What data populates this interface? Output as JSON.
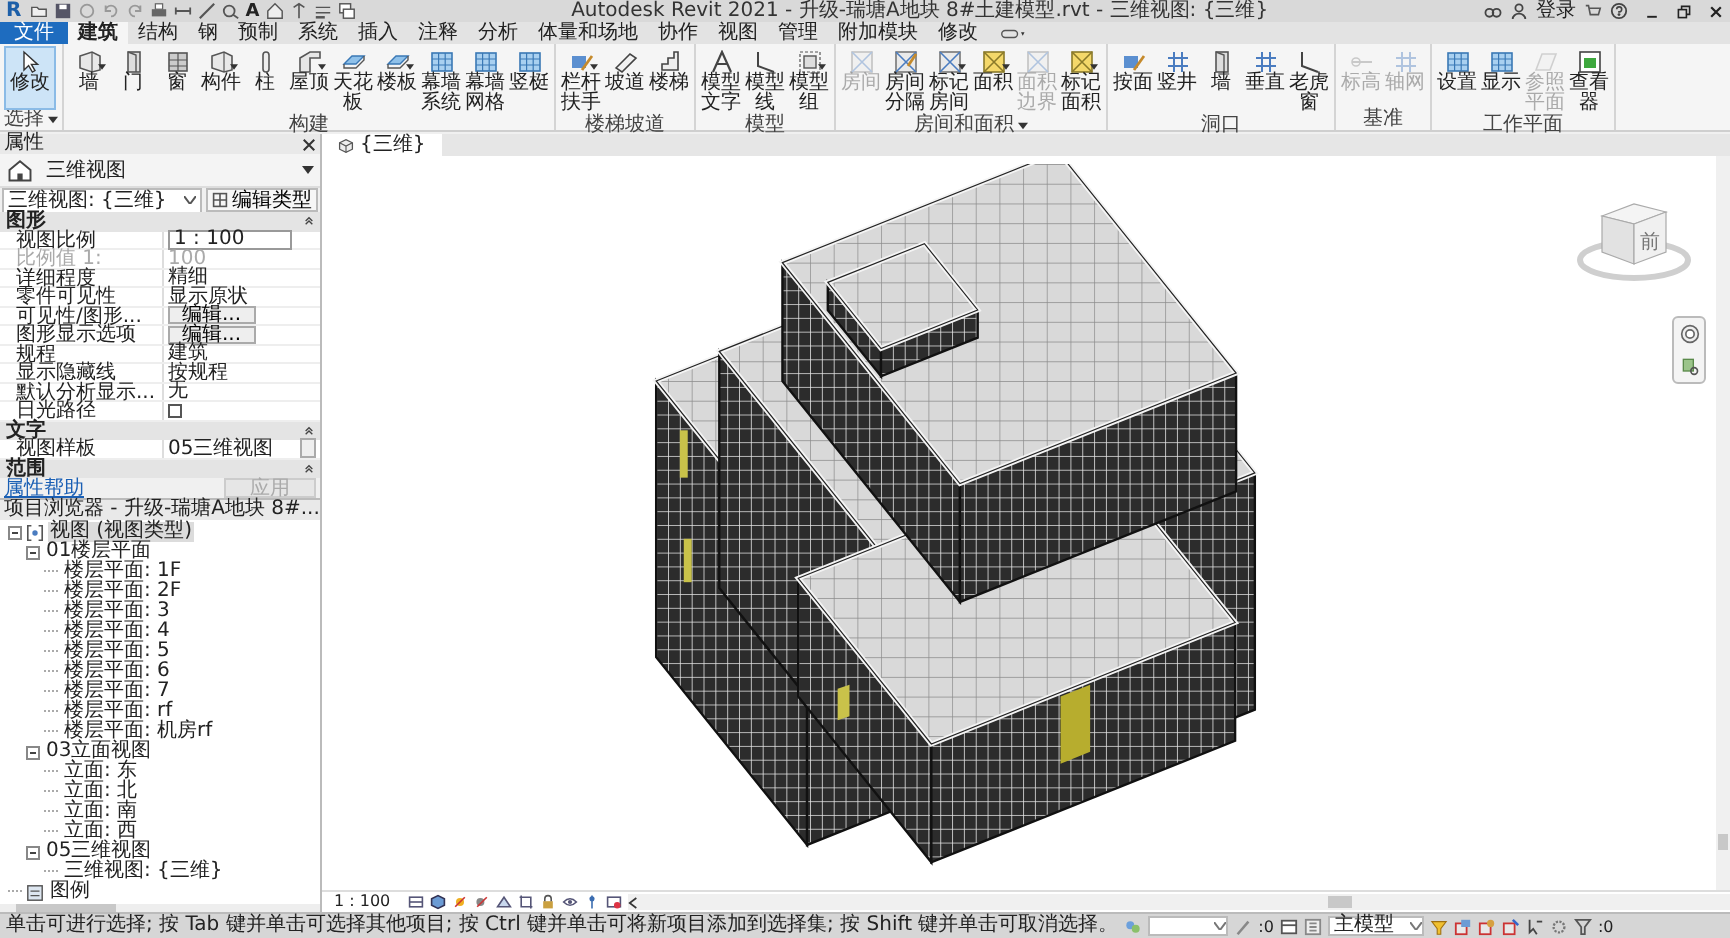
{
  "title_bar": {
    "app_letter": "R",
    "text_tool": "A",
    "title": "Autodesk Revit 2021 - 升级-瑞塘A地块 8#土建模型.rvt - 三维视图: {三维}",
    "sign_in": "登录"
  },
  "ribbon_tabs": [
    {
      "label": "文件",
      "kind": "file",
      "selected": false
    },
    {
      "label": "建筑",
      "kind": "tab",
      "selected": true
    },
    {
      "label": "结构",
      "kind": "tab",
      "selected": false
    },
    {
      "label": "钢",
      "kind": "tab",
      "selected": false
    },
    {
      "label": "预制",
      "kind": "tab",
      "selected": false
    },
    {
      "label": "系统",
      "kind": "tab",
      "selected": false
    },
    {
      "label": "插入",
      "kind": "tab",
      "selected": false
    },
    {
      "label": "注释",
      "kind": "tab",
      "selected": false
    },
    {
      "label": "分析",
      "kind": "tab",
      "selected": false
    },
    {
      "label": "体量和场地",
      "kind": "tab",
      "selected": false
    },
    {
      "label": "协作",
      "kind": "tab",
      "selected": false
    },
    {
      "label": "视图",
      "kind": "tab",
      "selected": false
    },
    {
      "label": "管理",
      "kind": "tab",
      "selected": false
    },
    {
      "label": "附加模块",
      "kind": "tab",
      "selected": false
    },
    {
      "label": "修改",
      "kind": "tab",
      "selected": false
    }
  ],
  "ribbon_panels": [
    {
      "label": "选择",
      "has_menu": true,
      "buttons": [
        {
          "label": "修改",
          "selected": true,
          "disabled": false,
          "has_menu": false
        }
      ]
    },
    {
      "label": "构建",
      "has_menu": false,
      "buttons": [
        {
          "label": "墙",
          "selected": false,
          "disabled": false,
          "has_menu": true
        },
        {
          "label": "门",
          "selected": false,
          "disabled": false,
          "has_menu": false
        },
        {
          "label": "窗",
          "selected": false,
          "disabled": false,
          "has_menu": false
        },
        {
          "label": "构件",
          "selected": false,
          "disabled": false,
          "has_menu": true
        },
        {
          "label": "柱",
          "selected": false,
          "disabled": false,
          "has_menu": false
        },
        {
          "label": "屋顶",
          "selected": false,
          "disabled": false,
          "has_menu": true
        },
        {
          "label": "天花板",
          "selected": false,
          "disabled": false,
          "has_menu": false
        },
        {
          "label": "楼板",
          "selected": false,
          "disabled": false,
          "has_menu": true
        },
        {
          "label": "幕墙系统",
          "selected": false,
          "disabled": false,
          "has_menu": false
        },
        {
          "label": "幕墙网格",
          "selected": false,
          "disabled": false,
          "has_menu": false
        },
        {
          "label": "竖梃",
          "selected": false,
          "disabled": false,
          "has_menu": false
        }
      ]
    },
    {
      "label": "楼梯坡道",
      "has_menu": false,
      "buttons": [
        {
          "label": "栏杆扶手",
          "selected": false,
          "disabled": false,
          "has_menu": true
        },
        {
          "label": "坡道",
          "selected": false,
          "disabled": false,
          "has_menu": false
        },
        {
          "label": "楼梯",
          "selected": false,
          "disabled": false,
          "has_menu": false
        }
      ]
    },
    {
      "label": "模型",
      "has_menu": false,
      "buttons": [
        {
          "label": "模型文字",
          "selected": false,
          "disabled": false,
          "has_menu": false
        },
        {
          "label": "模型线",
          "selected": false,
          "disabled": false,
          "has_menu": false
        },
        {
          "label": "模型组",
          "selected": false,
          "disabled": false,
          "has_menu": true
        }
      ]
    },
    {
      "label": "房间和面积",
      "has_menu": true,
      "buttons": [
        {
          "label": "房间",
          "selected": false,
          "disabled": true,
          "has_menu": false
        },
        {
          "label": "房间分隔",
          "selected": false,
          "disabled": false,
          "has_menu": false
        },
        {
          "label": "标记房间",
          "selected": false,
          "disabled": false,
          "has_menu": true
        },
        {
          "label": "面积",
          "selected": false,
          "disabled": false,
          "has_menu": true
        },
        {
          "label": "面积边界",
          "selected": false,
          "disabled": true,
          "has_menu": false
        },
        {
          "label": "标记面积",
          "selected": false,
          "disabled": false,
          "has_menu": true
        }
      ]
    },
    {
      "label": "洞口",
      "has_menu": false,
      "buttons": [
        {
          "label": "按面",
          "selected": false,
          "disabled": false,
          "has_menu": false
        },
        {
          "label": "竖井",
          "selected": false,
          "disabled": false,
          "has_menu": false
        },
        {
          "label": "墙",
          "selected": false,
          "disabled": false,
          "has_menu": false
        },
        {
          "label": "垂直",
          "selected": false,
          "disabled": false,
          "has_menu": false
        },
        {
          "label": "老虎窗",
          "selected": false,
          "disabled": false,
          "has_menu": false
        }
      ]
    },
    {
      "label": "基准",
      "has_menu": false,
      "buttons": [
        {
          "label": "标高",
          "selected": false,
          "disabled": true,
          "has_menu": false
        },
        {
          "label": "轴网",
          "selected": false,
          "disabled": true,
          "has_menu": false
        }
      ]
    },
    {
      "label": "工作平面",
      "has_menu": false,
      "buttons": [
        {
          "label": "设置",
          "selected": false,
          "disabled": false,
          "has_menu": false
        },
        {
          "label": "显示",
          "selected": false,
          "disabled": false,
          "has_menu": false
        },
        {
          "label": "参照平面",
          "selected": false,
          "disabled": true,
          "has_menu": false
        },
        {
          "label": "查看器",
          "selected": false,
          "disabled": false,
          "has_menu": false
        }
      ]
    }
  ],
  "properties": {
    "title": "属性",
    "type_name": "三维视图",
    "instance": "三维视图: {三维}",
    "edit_type": "编辑类型",
    "rows": [
      {
        "kind": "group",
        "label": "图形"
      },
      {
        "kind": "input",
        "label": "视图比例",
        "value": "1 : 100",
        "disabled": false
      },
      {
        "kind": "text",
        "label": "比例值 1:",
        "value": "100",
        "disabled": true
      },
      {
        "kind": "text",
        "label": "详细程度",
        "value": "精细",
        "disabled": false
      },
      {
        "kind": "text",
        "label": "零件可见性",
        "value": "显示原状",
        "disabled": false
      },
      {
        "kind": "button",
        "label": "可见性/图形...",
        "value": "编辑...",
        "disabled": false
      },
      {
        "kind": "button",
        "label": "图形显示选项",
        "value": "编辑...",
        "disabled": false
      },
      {
        "kind": "text",
        "label": "规程",
        "value": "建筑",
        "disabled": false
      },
      {
        "kind": "text",
        "label": "显示隐藏线",
        "value": "按规程",
        "disabled": false
      },
      {
        "kind": "text",
        "label": "默认分析显示...",
        "value": "无",
        "disabled": false
      },
      {
        "kind": "checkbox",
        "label": "日光路径",
        "checked": false,
        "disabled": false
      },
      {
        "kind": "group",
        "label": "文字"
      },
      {
        "kind": "picker",
        "label": "视图样板",
        "value": "05三维视图",
        "disabled": false
      },
      {
        "kind": "group",
        "label": "范围"
      }
    ],
    "help_link": "属性帮助",
    "apply": {
      "label": "应用",
      "disabled": true
    }
  },
  "project_browser": {
    "title": "项目浏览器 - 升级-瑞塘A地块 8#...",
    "tree": [
      {
        "label": "视图 (视图类型)",
        "kind": "views",
        "selected": true,
        "expanded": true,
        "children": [
          {
            "label": "01楼层平面",
            "selected": false,
            "expanded": true,
            "children": [
              {
                "label": "楼层平面: 1F",
                "selected": false
              },
              {
                "label": "楼层平面: 2F",
                "selected": false
              },
              {
                "label": "楼层平面: 3",
                "selected": false
              },
              {
                "label": "楼层平面: 4",
                "selected": false
              },
              {
                "label": "楼层平面: 5",
                "selected": false
              },
              {
                "label": "楼层平面: 6",
                "selected": false
              },
              {
                "label": "楼层平面: 7",
                "selected": false
              },
              {
                "label": "楼层平面: rf",
                "selected": false
              },
              {
                "label": "楼层平面: 机房rf",
                "selected": false
              }
            ]
          },
          {
            "label": "03立面视图",
            "selected": false,
            "expanded": true,
            "children": [
              {
                "label": "立面: 东",
                "selected": false
              },
              {
                "label": "立面: 北",
                "selected": false
              },
              {
                "label": "立面: 南",
                "selected": false
              },
              {
                "label": "立面: 西",
                "selected": false
              }
            ]
          },
          {
            "label": "05三维视图",
            "selected": false,
            "expanded": true,
            "children": [
              {
                "label": "三维视图: {三维}",
                "selected": false
              }
            ]
          }
        ]
      },
      {
        "label": "图例",
        "kind": "legends",
        "selected": false
      }
    ]
  },
  "view": {
    "tab": "{三维}",
    "cube_face": "前",
    "scale": "1 : 100"
  },
  "status_bar": {
    "hint": "单击可进行选择; 按 Tab 键并单击可选择其他项目; 按 Ctrl 键并单击可将新项目添加到选择集; 按 Shift 键并单击可取消选择。",
    "editable_count": ":0",
    "design_option": "主模型",
    "filter_count": ":0"
  }
}
